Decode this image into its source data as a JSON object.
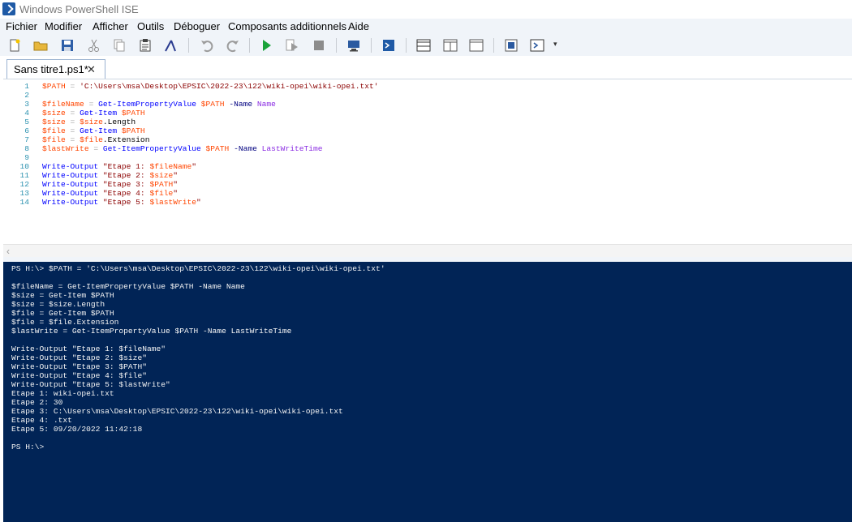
{
  "window": {
    "title": "Windows PowerShell ISE"
  },
  "menu": [
    "Fichier",
    "Modifier",
    "Afficher",
    "Outils",
    "Déboguer",
    "Composants additionnels",
    "Aide"
  ],
  "toolbar": {
    "buttons": [
      "new-file-icon",
      "open-folder-icon",
      "save-icon",
      "cut-icon",
      "copy-icon",
      "paste-icon",
      "clear-console-icon",
      "undo-icon",
      "redo-icon",
      "run-icon",
      "run-selection-icon",
      "stop-icon",
      "new-remote-tab-icon",
      "start-powershell-icon",
      "show-script-top-icon",
      "show-script-right-icon",
      "show-script-maximized-icon",
      "show-command-window-icon",
      "show-command-addon-icon"
    ],
    "overflow": "▾"
  },
  "tab": {
    "label": "Sans titre1.ps1*",
    "close": "✕"
  },
  "editor": {
    "line_numbers": [
      "1",
      "2",
      "3",
      "4",
      "5",
      "6",
      "7",
      "8",
      "9",
      "10",
      "11",
      "12",
      "13",
      "14"
    ],
    "lines": [
      [
        {
          "t": "var",
          "v": "$PATH"
        },
        {
          "t": "op",
          "v": " = "
        },
        {
          "t": "str",
          "v": "'C:\\Users\\msa\\Desktop\\EPSIC\\2022-23\\122\\wiki-opei\\wiki-opei.txt'"
        }
      ],
      [],
      [
        {
          "t": "var",
          "v": "$fileName"
        },
        {
          "t": "op",
          "v": " = "
        },
        {
          "t": "cmd",
          "v": "Get-ItemPropertyValue"
        },
        {
          "t": "mem",
          "v": " "
        },
        {
          "t": "var",
          "v": "$PATH"
        },
        {
          "t": "mem",
          "v": " "
        },
        {
          "t": "prm",
          "v": "-Name"
        },
        {
          "t": "mem",
          "v": " "
        },
        {
          "t": "arg",
          "v": "Name"
        }
      ],
      [
        {
          "t": "var",
          "v": "$size"
        },
        {
          "t": "op",
          "v": " = "
        },
        {
          "t": "cmd",
          "v": "Get-Item"
        },
        {
          "t": "mem",
          "v": " "
        },
        {
          "t": "var",
          "v": "$PATH"
        }
      ],
      [
        {
          "t": "var",
          "v": "$size"
        },
        {
          "t": "op",
          "v": " = "
        },
        {
          "t": "var",
          "v": "$size"
        },
        {
          "t": "mem",
          "v": ".Length"
        }
      ],
      [
        {
          "t": "var",
          "v": "$file"
        },
        {
          "t": "op",
          "v": " = "
        },
        {
          "t": "cmd",
          "v": "Get-Item"
        },
        {
          "t": "mem",
          "v": " "
        },
        {
          "t": "var",
          "v": "$PATH"
        }
      ],
      [
        {
          "t": "var",
          "v": "$file"
        },
        {
          "t": "op",
          "v": " = "
        },
        {
          "t": "var",
          "v": "$file"
        },
        {
          "t": "mem",
          "v": ".Extension"
        }
      ],
      [
        {
          "t": "var",
          "v": "$lastWrite"
        },
        {
          "t": "op",
          "v": " = "
        },
        {
          "t": "cmd",
          "v": "Get-ItemPropertyValue"
        },
        {
          "t": "mem",
          "v": " "
        },
        {
          "t": "var",
          "v": "$PATH"
        },
        {
          "t": "mem",
          "v": " "
        },
        {
          "t": "prm",
          "v": "-Name"
        },
        {
          "t": "mem",
          "v": " "
        },
        {
          "t": "arg",
          "v": "LastWriteTime"
        }
      ],
      [],
      [
        {
          "t": "cmd",
          "v": "Write-Output"
        },
        {
          "t": "mem",
          "v": " "
        },
        {
          "t": "str",
          "v": "\"Etape 1: "
        },
        {
          "t": "var",
          "v": "$fileName"
        },
        {
          "t": "str",
          "v": "\""
        }
      ],
      [
        {
          "t": "cmd",
          "v": "Write-Output"
        },
        {
          "t": "mem",
          "v": " "
        },
        {
          "t": "str",
          "v": "\"Etape 2: "
        },
        {
          "t": "var",
          "v": "$size"
        },
        {
          "t": "str",
          "v": "\""
        }
      ],
      [
        {
          "t": "cmd",
          "v": "Write-Output"
        },
        {
          "t": "mem",
          "v": " "
        },
        {
          "t": "str",
          "v": "\"Etape 3: "
        },
        {
          "t": "var",
          "v": "$PATH"
        },
        {
          "t": "str",
          "v": "\""
        }
      ],
      [
        {
          "t": "cmd",
          "v": "Write-Output"
        },
        {
          "t": "mem",
          "v": " "
        },
        {
          "t": "str",
          "v": "\"Etape 4: "
        },
        {
          "t": "var",
          "v": "$file"
        },
        {
          "t": "str",
          "v": "\""
        }
      ],
      [
        {
          "t": "cmd",
          "v": "Write-Output"
        },
        {
          "t": "mem",
          "v": " "
        },
        {
          "t": "str",
          "v": "\"Etape 5: "
        },
        {
          "t": "var",
          "v": "$lastWrite"
        },
        {
          "t": "str",
          "v": "\""
        }
      ]
    ]
  },
  "scrollbar": {
    "left_arrow": "‹"
  },
  "console": {
    "lines": [
      "PS H:\\> $PATH = 'C:\\Users\\msa\\Desktop\\EPSIC\\2022-23\\122\\wiki-opei\\wiki-opei.txt'",
      "",
      "$fileName = Get-ItemPropertyValue $PATH -Name Name",
      "$size = Get-Item $PATH",
      "$size = $size.Length",
      "$file = Get-Item $PATH",
      "$file = $file.Extension",
      "$lastWrite = Get-ItemPropertyValue $PATH -Name LastWriteTime",
      "",
      "Write-Output \"Etape 1: $fileName\"",
      "Write-Output \"Etape 2: $size\"",
      "Write-Output \"Etape 3: $PATH\"",
      "Write-Output \"Etape 4: $file\"",
      "Write-Output \"Etape 5: $lastWrite\"",
      "Etape 1: wiki-opei.txt",
      "Etape 2: 30",
      "Etape 3: C:\\Users\\msa\\Desktop\\EPSIC\\2022-23\\122\\wiki-opei\\wiki-opei.txt",
      "Etape 4: .txt",
      "Etape 5: 09/20/2022 11:42:18",
      "",
      "PS H:\\>"
    ]
  },
  "colors": {
    "console_bg": "#012456",
    "menu_bg": "#f0f4f9",
    "line_number": "#2b91af",
    "variable": "#ff4500",
    "cmdlet": "#0000ff",
    "string": "#8b0000",
    "parameter": "#000080",
    "argument": "#8a2be2"
  }
}
